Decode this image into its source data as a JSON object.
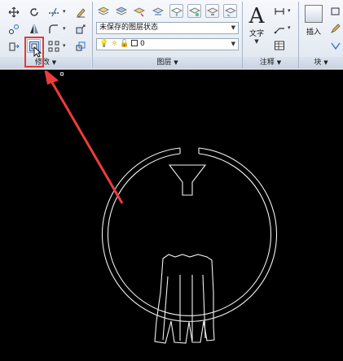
{
  "ribbon": {
    "modify_panel": {
      "title": "修改",
      "dropdown": "▼"
    },
    "layers_panel": {
      "title": "图层",
      "layer_state_value": "未保存的图层状态",
      "layer_value": "0",
      "dropdown": "▼"
    },
    "text_button": {
      "glyph": "A",
      "label": "文字"
    },
    "annotation_panel": {
      "title": "注释",
      "dropdown": "▼"
    },
    "insert_button": {
      "label": "插入"
    },
    "block_panel": {
      "title": "块",
      "dropdown": "▼"
    }
  },
  "colors": {
    "ribbon_bg": "#e6ecf4",
    "highlight": "#e53935",
    "arrow": "#ef3b3b",
    "drawing_lines": "#ffffff",
    "canvas_bg": "#000000"
  }
}
